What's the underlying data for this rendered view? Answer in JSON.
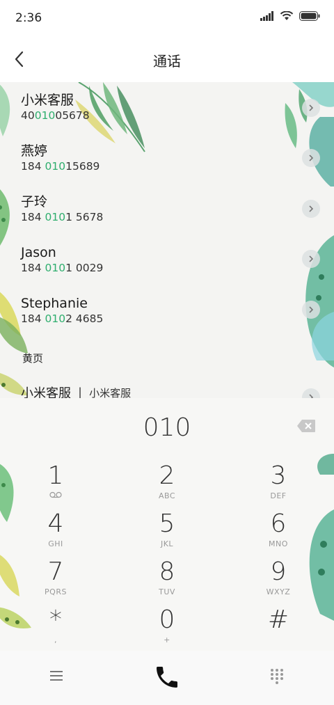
{
  "status": {
    "time": "2:36",
    "icons": [
      "signal-icon",
      "wifi-icon",
      "battery-icon"
    ]
  },
  "header": {
    "title": "通话"
  },
  "contacts": [
    {
      "name": "小米客服",
      "number_pre": "40",
      "number_match": "010",
      "number_post": "05678"
    },
    {
      "name": "燕婷",
      "number_pre": "184 ",
      "number_match": "010",
      "number_post": "15689"
    },
    {
      "name": "子玲",
      "number_pre": "184 ",
      "number_match": "010",
      "number_post": "1 5678"
    },
    {
      "name": "Jason",
      "number_pre": "184 ",
      "number_match": "010",
      "number_post": "1 0029"
    },
    {
      "name": "Stephanie",
      "number_pre": "184 ",
      "number_match": "010",
      "number_post": "2 4685"
    }
  ],
  "yellow_pages": {
    "section_label": "黄页",
    "entry_name": "小米客服",
    "separator": "|",
    "entry_sub": "小米客服"
  },
  "dialer": {
    "input_value": "010",
    "keys": [
      {
        "digit": "1",
        "letters": ""
      },
      {
        "digit": "2",
        "letters": "ABC"
      },
      {
        "digit": "3",
        "letters": "DEF"
      },
      {
        "digit": "4",
        "letters": "GHI"
      },
      {
        "digit": "5",
        "letters": "JKL"
      },
      {
        "digit": "6",
        "letters": "MNO"
      },
      {
        "digit": "7",
        "letters": "PQRS"
      },
      {
        "digit": "8",
        "letters": "TUV"
      },
      {
        "digit": "9",
        "letters": "WXYZ"
      },
      {
        "digit": "*",
        "letters": ","
      },
      {
        "digit": "0",
        "letters": "+"
      },
      {
        "digit": "#",
        "letters": ""
      }
    ]
  },
  "bottom_bar": {
    "icons": [
      "menu-icon",
      "phone-icon",
      "keypad-icon"
    ]
  },
  "colors": {
    "match_highlight": "#2fae6e",
    "leaf_green": "#5cb88a",
    "leaf_yellow": "#cfd84a"
  }
}
